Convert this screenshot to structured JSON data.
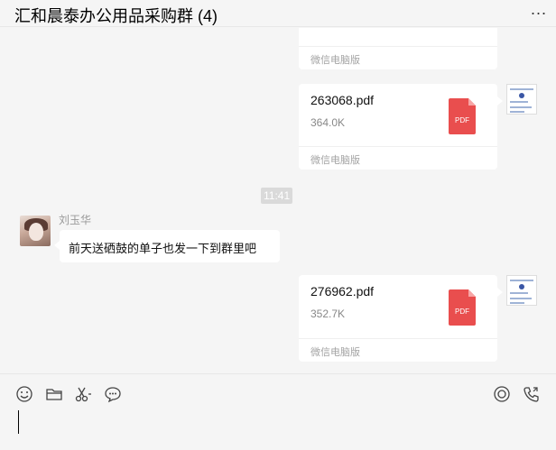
{
  "window": {
    "title": "汇和晨泰办公用品采购群 (4)",
    "more_label": "..."
  },
  "messages": {
    "partial_file": {
      "source": "微信电脑版"
    },
    "file1": {
      "name": "263068.pdf",
      "size": "364.0K",
      "icon_label": "PDF",
      "source": "微信电脑版"
    },
    "timestamp": "11:41",
    "text_message": {
      "sender": "刘玉华",
      "text": "前天送硒鼓的单子也发一下到群里吧"
    },
    "file2": {
      "name": "276962.pdf",
      "size": "352.7K",
      "icon_label": "PDF",
      "source": "微信电脑版"
    }
  },
  "toolbar": {
    "left_icons": [
      "emoji-icon",
      "folder-icon",
      "scissors-icon",
      "chat-bubble-icon"
    ],
    "right_icons": [
      "live-icon",
      "voice-call-icon"
    ]
  },
  "input": {
    "value": ""
  },
  "colors": {
    "pdf_red": "#e94e4e",
    "background": "#f5f5f5",
    "bubble": "#ffffff"
  }
}
